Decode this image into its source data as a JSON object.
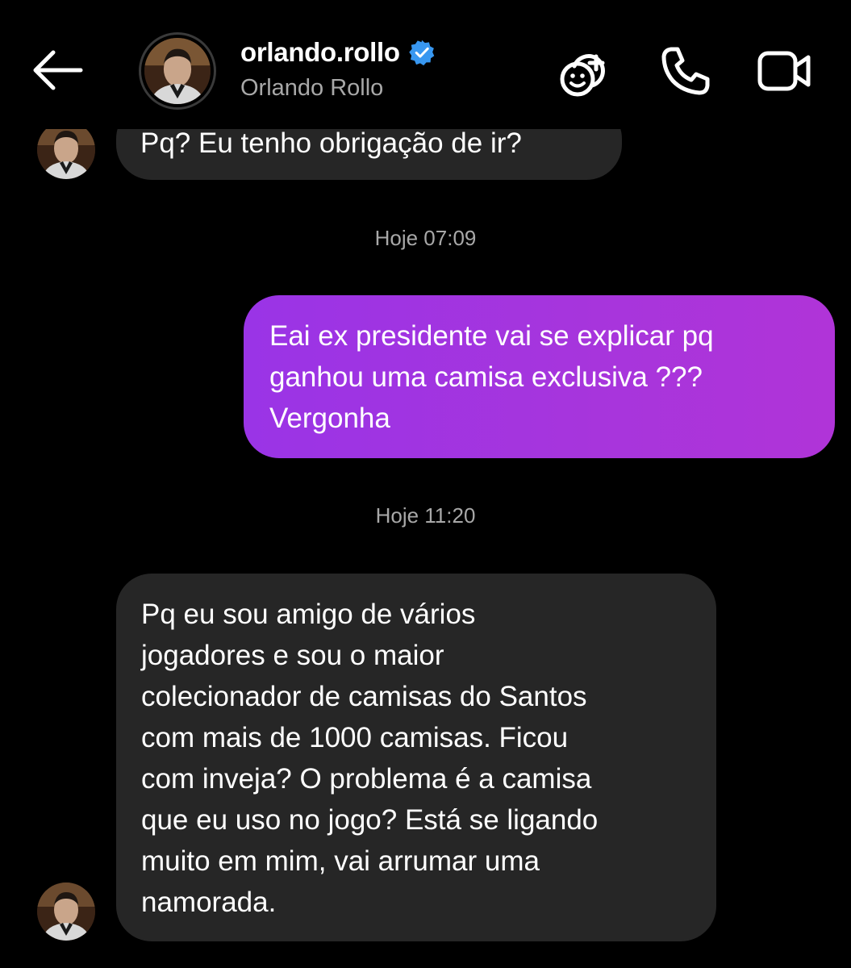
{
  "header": {
    "username": "orlando.rollo",
    "display_name": "Orlando Rollo",
    "verified": true,
    "icons": [
      "back-arrow-icon",
      "effects-icon",
      "phone-icon",
      "video-camera-icon",
      "verified-badge-icon"
    ]
  },
  "messages": [
    {
      "direction": "incoming",
      "lines": [
        "Pq? Eu tenho obrigação de ir?"
      ]
    },
    {
      "direction": "outgoing",
      "lines": [
        "Eai ex presidente vai se explicar pq",
        "ganhou uma camisa exclusiva ???",
        "Vergonha"
      ]
    },
    {
      "direction": "incoming",
      "lines": [
        "Pq eu sou amigo de vários",
        "jogadores e sou o maior",
        "colecionador de camisas do Santos",
        "com mais de 1000 camisas. Ficou",
        "com inveja? O problema é a camisa",
        "que eu uso no jogo? Está se ligando",
        "muito em mim, vai arrumar uma",
        "namorada."
      ]
    }
  ],
  "timestamps": [
    "Hoje 07:09",
    "Hoje 11:20"
  ],
  "colors": {
    "background": "#000000",
    "incoming_bubble": "#262626",
    "outgoing_gradient_start": "#9a34e6",
    "outgoing_gradient_end": "#b034d8",
    "secondary_text": "#a8a8a8",
    "verified_blue": "#3897f0"
  }
}
